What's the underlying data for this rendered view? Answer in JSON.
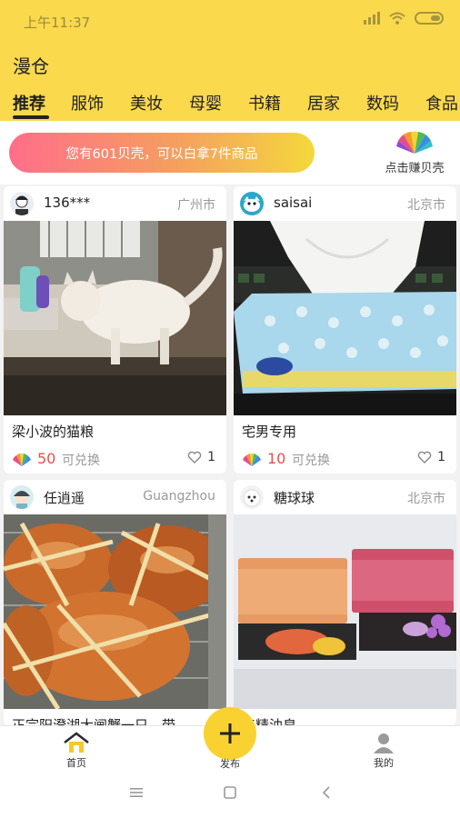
{
  "status_bar": {
    "time": "上午11:37"
  },
  "app": {
    "title": "漫仓"
  },
  "tabs": [
    "推荐",
    "服饰",
    "美妆",
    "母婴",
    "书籍",
    "居家",
    "数码",
    "食品"
  ],
  "banner": {
    "text": "您有601贝壳，可以白拿7件商品",
    "earn_label": "点击赚贝壳"
  },
  "cards": [
    {
      "user": "136***",
      "city": "广州市",
      "title": "梁小波的猫粮",
      "price": "50",
      "redeem": "可兑换",
      "likes": "1"
    },
    {
      "user": "saisai",
      "city": "北京市",
      "title": "宅男专用",
      "price": "10",
      "redeem": "可兑换",
      "likes": "1"
    },
    {
      "user": "任逍遥",
      "city": "Guangzhou",
      "title": "正宗阳澄湖大闸蟹一只，带",
      "price": "",
      "redeem": "",
      "likes": ""
    },
    {
      "user": "糖球球",
      "city": "北京市",
      "title": "工精油皂",
      "price": "",
      "redeem": "",
      "likes": ""
    }
  ],
  "bottom_nav": {
    "home": "首页",
    "publish": "发布",
    "mine": "我的"
  },
  "colors": {
    "brand_yellow": "#fbd94c",
    "price_red": "#e8504a",
    "fab_yellow": "#f9d232"
  }
}
